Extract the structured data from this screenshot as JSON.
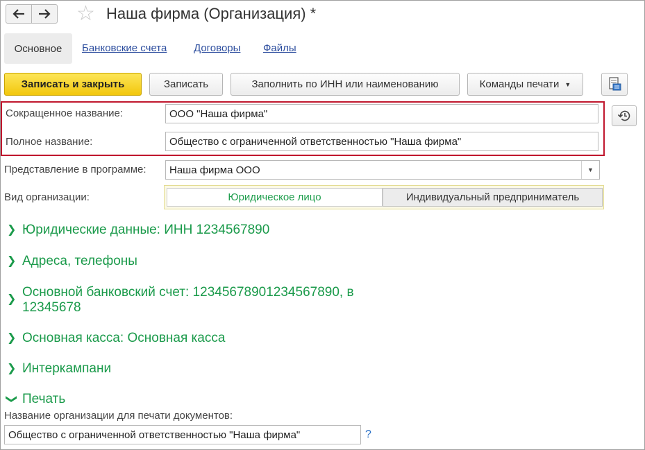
{
  "window": {
    "title": "Наша фирма (Организация) *"
  },
  "tabs": {
    "active": "Основное",
    "links": [
      "Банковские счета",
      "Договоры",
      "Файлы"
    ]
  },
  "toolbar": {
    "save_close": "Записать и закрыть",
    "save": "Записать",
    "fill_inn": "Заполнить по ИНН или наименованию",
    "print_cmds": "Команды печати"
  },
  "form": {
    "short_name_label": "Сокращенное название:",
    "short_name_value": "ООО \"Наша фирма\"",
    "full_name_label": "Полное название:",
    "full_name_value": "Общество с ограниченной ответственностью \"Наша фирма\"",
    "representation_label": "Представление в программе:",
    "representation_value": "Наша фирма ООО",
    "org_type_label": "Вид организации:",
    "org_type_options": [
      "Юридическое лицо",
      "Индивидуальный предприниматель"
    ],
    "org_type_selected": "Юридическое лицо"
  },
  "sections": {
    "legal": "Юридические данные: ИНН 1234567890",
    "addresses": "Адреса, телефоны",
    "bank_line1": "Основной банковский счет: 12345678901234567890, в",
    "bank_line2": "12345678",
    "cash": "Основная касса: Основная касса",
    "intercompany": "Интеркампани",
    "print": "Печать"
  },
  "print_section": {
    "label": "Название организации для печати документов:",
    "value": "Общество с ограниченной ответственностью \"Наша фирма\"",
    "help": "?"
  },
  "colors": {
    "accent_green": "#1a9a4a",
    "link_blue": "#2c4d9e",
    "highlight_red": "#c0162d",
    "primary_yellow": "#f2c70c"
  }
}
